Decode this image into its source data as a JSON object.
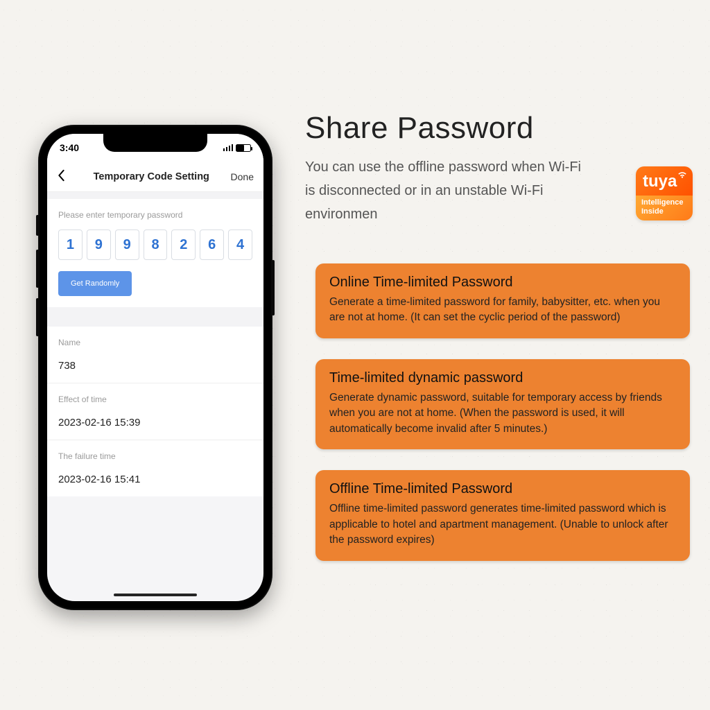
{
  "marketing": {
    "title": "Share Password",
    "subtitle": "You can use the offline password when Wi-Fi is disconnected or in an unstable Wi-Fi environmen"
  },
  "badge": {
    "brand": "tuya",
    "tagline": "Intelligence Inside"
  },
  "cards": [
    {
      "title": "Online Time-limited Password",
      "body": "Generate a time-limited password for family, babysitter, etc. when you are not at home.  (It can set the cyclic period of the password)"
    },
    {
      "title": "Time-limited dynamic password",
      "body": "Generate dynamic password, suitable for temporary access by friends when you are not at home. (When the password is used, it will automatically become invalid after 5 minutes.)"
    },
    {
      "title": "Offline Time-limited Password",
      "body": "Offline time-limited password generates time-limited password which is applicable to hotel and apartment management. (Unable to unlock after the password expires)"
    }
  ],
  "phone": {
    "status_time": "3:40",
    "nav": {
      "title": "Temporary Code Setting",
      "done": "Done"
    },
    "prompt": "Please enter temporary password",
    "pin": [
      "1",
      "9",
      "9",
      "8",
      "2",
      "6",
      "4"
    ],
    "get_randomly": "Get Randomly",
    "name_label": "Name",
    "name_value": "738",
    "effect_label": "Effect of time",
    "effect_value": "2023-02-16 15:39",
    "fail_label": "The failure time",
    "fail_value": "2023-02-16 15:41"
  }
}
